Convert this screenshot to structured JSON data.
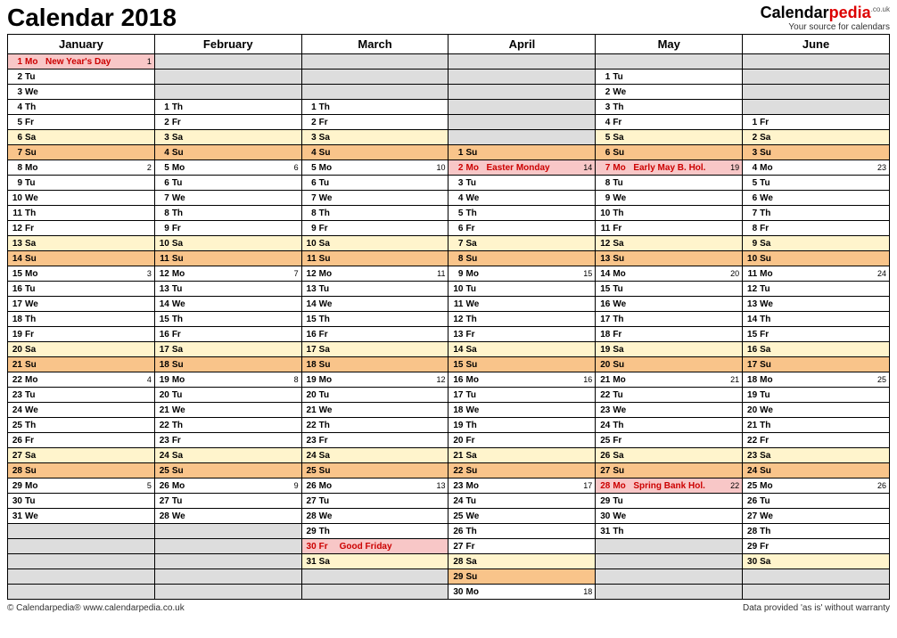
{
  "title": "Calendar 2018",
  "logo": {
    "part1": "Calendar",
    "part2": "pedia",
    "tld": ".co.uk",
    "tagline": "Your source for calendars"
  },
  "months": [
    "January",
    "February",
    "March",
    "April",
    "May",
    "June"
  ],
  "footer": {
    "left": "© Calendarpedia®   www.calendarpedia.co.uk",
    "right": "Data provided 'as is' without warranty"
  },
  "grid": [
    [
      {
        "d": 1,
        "w": "Mo",
        "ev": "New Year's Day",
        "wk": 1,
        "cls": "hol"
      },
      null,
      null,
      null,
      null,
      null
    ],
    [
      {
        "d": 2,
        "w": "Tu"
      },
      null,
      null,
      null,
      {
        "d": 1,
        "w": "Tu"
      },
      null
    ],
    [
      {
        "d": 3,
        "w": "We"
      },
      null,
      null,
      null,
      {
        "d": 2,
        "w": "We"
      },
      null
    ],
    [
      {
        "d": 4,
        "w": "Th"
      },
      {
        "d": 1,
        "w": "Th"
      },
      {
        "d": 1,
        "w": "Th"
      },
      null,
      {
        "d": 3,
        "w": "Th"
      },
      null
    ],
    [
      {
        "d": 5,
        "w": "Fr"
      },
      {
        "d": 2,
        "w": "Fr"
      },
      {
        "d": 2,
        "w": "Fr"
      },
      null,
      {
        "d": 4,
        "w": "Fr"
      },
      {
        "d": 1,
        "w": "Fr"
      }
    ],
    [
      {
        "d": 6,
        "w": "Sa",
        "cls": "sa"
      },
      {
        "d": 3,
        "w": "Sa",
        "cls": "sa"
      },
      {
        "d": 3,
        "w": "Sa",
        "cls": "sa"
      },
      null,
      {
        "d": 5,
        "w": "Sa",
        "cls": "sa"
      },
      {
        "d": 2,
        "w": "Sa",
        "cls": "sa"
      }
    ],
    [
      {
        "d": 7,
        "w": "Su",
        "cls": "su"
      },
      {
        "d": 4,
        "w": "Su",
        "cls": "su"
      },
      {
        "d": 4,
        "w": "Su",
        "cls": "su"
      },
      {
        "d": 1,
        "w": "Su",
        "cls": "su"
      },
      {
        "d": 6,
        "w": "Su",
        "cls": "su"
      },
      {
        "d": 3,
        "w": "Su",
        "cls": "su"
      }
    ],
    [
      {
        "d": 8,
        "w": "Mo",
        "wk": 2
      },
      {
        "d": 5,
        "w": "Mo",
        "wk": 6
      },
      {
        "d": 5,
        "w": "Mo",
        "wk": 10
      },
      {
        "d": 2,
        "w": "Mo",
        "ev": "Easter Monday",
        "wk": 14,
        "cls": "hol"
      },
      {
        "d": 7,
        "w": "Mo",
        "ev": "Early May B. Hol.",
        "wk": 19,
        "cls": "hol"
      },
      {
        "d": 4,
        "w": "Mo",
        "wk": 23
      }
    ],
    [
      {
        "d": 9,
        "w": "Tu"
      },
      {
        "d": 6,
        "w": "Tu"
      },
      {
        "d": 6,
        "w": "Tu"
      },
      {
        "d": 3,
        "w": "Tu"
      },
      {
        "d": 8,
        "w": "Tu"
      },
      {
        "d": 5,
        "w": "Tu"
      }
    ],
    [
      {
        "d": 10,
        "w": "We"
      },
      {
        "d": 7,
        "w": "We"
      },
      {
        "d": 7,
        "w": "We"
      },
      {
        "d": 4,
        "w": "We"
      },
      {
        "d": 9,
        "w": "We"
      },
      {
        "d": 6,
        "w": "We"
      }
    ],
    [
      {
        "d": 11,
        "w": "Th"
      },
      {
        "d": 8,
        "w": "Th"
      },
      {
        "d": 8,
        "w": "Th"
      },
      {
        "d": 5,
        "w": "Th"
      },
      {
        "d": 10,
        "w": "Th"
      },
      {
        "d": 7,
        "w": "Th"
      }
    ],
    [
      {
        "d": 12,
        "w": "Fr"
      },
      {
        "d": 9,
        "w": "Fr"
      },
      {
        "d": 9,
        "w": "Fr"
      },
      {
        "d": 6,
        "w": "Fr"
      },
      {
        "d": 11,
        "w": "Fr"
      },
      {
        "d": 8,
        "w": "Fr"
      }
    ],
    [
      {
        "d": 13,
        "w": "Sa",
        "cls": "sa"
      },
      {
        "d": 10,
        "w": "Sa",
        "cls": "sa"
      },
      {
        "d": 10,
        "w": "Sa",
        "cls": "sa"
      },
      {
        "d": 7,
        "w": "Sa",
        "cls": "sa"
      },
      {
        "d": 12,
        "w": "Sa",
        "cls": "sa"
      },
      {
        "d": 9,
        "w": "Sa",
        "cls": "sa"
      }
    ],
    [
      {
        "d": 14,
        "w": "Su",
        "cls": "su"
      },
      {
        "d": 11,
        "w": "Su",
        "cls": "su"
      },
      {
        "d": 11,
        "w": "Su",
        "cls": "su"
      },
      {
        "d": 8,
        "w": "Su",
        "cls": "su"
      },
      {
        "d": 13,
        "w": "Su",
        "cls": "su"
      },
      {
        "d": 10,
        "w": "Su",
        "cls": "su"
      }
    ],
    [
      {
        "d": 15,
        "w": "Mo",
        "wk": 3
      },
      {
        "d": 12,
        "w": "Mo",
        "wk": 7
      },
      {
        "d": 12,
        "w": "Mo",
        "wk": 11
      },
      {
        "d": 9,
        "w": "Mo",
        "wk": 15
      },
      {
        "d": 14,
        "w": "Mo",
        "wk": 20
      },
      {
        "d": 11,
        "w": "Mo",
        "wk": 24
      }
    ],
    [
      {
        "d": 16,
        "w": "Tu"
      },
      {
        "d": 13,
        "w": "Tu"
      },
      {
        "d": 13,
        "w": "Tu"
      },
      {
        "d": 10,
        "w": "Tu"
      },
      {
        "d": 15,
        "w": "Tu"
      },
      {
        "d": 12,
        "w": "Tu"
      }
    ],
    [
      {
        "d": 17,
        "w": "We"
      },
      {
        "d": 14,
        "w": "We"
      },
      {
        "d": 14,
        "w": "We"
      },
      {
        "d": 11,
        "w": "We"
      },
      {
        "d": 16,
        "w": "We"
      },
      {
        "d": 13,
        "w": "We"
      }
    ],
    [
      {
        "d": 18,
        "w": "Th"
      },
      {
        "d": 15,
        "w": "Th"
      },
      {
        "d": 15,
        "w": "Th"
      },
      {
        "d": 12,
        "w": "Th"
      },
      {
        "d": 17,
        "w": "Th"
      },
      {
        "d": 14,
        "w": "Th"
      }
    ],
    [
      {
        "d": 19,
        "w": "Fr"
      },
      {
        "d": 16,
        "w": "Fr"
      },
      {
        "d": 16,
        "w": "Fr"
      },
      {
        "d": 13,
        "w": "Fr"
      },
      {
        "d": 18,
        "w": "Fr"
      },
      {
        "d": 15,
        "w": "Fr"
      }
    ],
    [
      {
        "d": 20,
        "w": "Sa",
        "cls": "sa"
      },
      {
        "d": 17,
        "w": "Sa",
        "cls": "sa"
      },
      {
        "d": 17,
        "w": "Sa",
        "cls": "sa"
      },
      {
        "d": 14,
        "w": "Sa",
        "cls": "sa"
      },
      {
        "d": 19,
        "w": "Sa",
        "cls": "sa"
      },
      {
        "d": 16,
        "w": "Sa",
        "cls": "sa"
      }
    ],
    [
      {
        "d": 21,
        "w": "Su",
        "cls": "su"
      },
      {
        "d": 18,
        "w": "Su",
        "cls": "su"
      },
      {
        "d": 18,
        "w": "Su",
        "cls": "su"
      },
      {
        "d": 15,
        "w": "Su",
        "cls": "su"
      },
      {
        "d": 20,
        "w": "Su",
        "cls": "su"
      },
      {
        "d": 17,
        "w": "Su",
        "cls": "su"
      }
    ],
    [
      {
        "d": 22,
        "w": "Mo",
        "wk": 4
      },
      {
        "d": 19,
        "w": "Mo",
        "wk": 8
      },
      {
        "d": 19,
        "w": "Mo",
        "wk": 12
      },
      {
        "d": 16,
        "w": "Mo",
        "wk": 16
      },
      {
        "d": 21,
        "w": "Mo",
        "wk": 21
      },
      {
        "d": 18,
        "w": "Mo",
        "wk": 25
      }
    ],
    [
      {
        "d": 23,
        "w": "Tu"
      },
      {
        "d": 20,
        "w": "Tu"
      },
      {
        "d": 20,
        "w": "Tu"
      },
      {
        "d": 17,
        "w": "Tu"
      },
      {
        "d": 22,
        "w": "Tu"
      },
      {
        "d": 19,
        "w": "Tu"
      }
    ],
    [
      {
        "d": 24,
        "w": "We"
      },
      {
        "d": 21,
        "w": "We"
      },
      {
        "d": 21,
        "w": "We"
      },
      {
        "d": 18,
        "w": "We"
      },
      {
        "d": 23,
        "w": "We"
      },
      {
        "d": 20,
        "w": "We"
      }
    ],
    [
      {
        "d": 25,
        "w": "Th"
      },
      {
        "d": 22,
        "w": "Th"
      },
      {
        "d": 22,
        "w": "Th"
      },
      {
        "d": 19,
        "w": "Th"
      },
      {
        "d": 24,
        "w": "Th"
      },
      {
        "d": 21,
        "w": "Th"
      }
    ],
    [
      {
        "d": 26,
        "w": "Fr"
      },
      {
        "d": 23,
        "w": "Fr"
      },
      {
        "d": 23,
        "w": "Fr"
      },
      {
        "d": 20,
        "w": "Fr"
      },
      {
        "d": 25,
        "w": "Fr"
      },
      {
        "d": 22,
        "w": "Fr"
      }
    ],
    [
      {
        "d": 27,
        "w": "Sa",
        "cls": "sa"
      },
      {
        "d": 24,
        "w": "Sa",
        "cls": "sa"
      },
      {
        "d": 24,
        "w": "Sa",
        "cls": "sa"
      },
      {
        "d": 21,
        "w": "Sa",
        "cls": "sa"
      },
      {
        "d": 26,
        "w": "Sa",
        "cls": "sa"
      },
      {
        "d": 23,
        "w": "Sa",
        "cls": "sa"
      }
    ],
    [
      {
        "d": 28,
        "w": "Su",
        "cls": "su"
      },
      {
        "d": 25,
        "w": "Su",
        "cls": "su"
      },
      {
        "d": 25,
        "w": "Su",
        "cls": "su"
      },
      {
        "d": 22,
        "w": "Su",
        "cls": "su"
      },
      {
        "d": 27,
        "w": "Su",
        "cls": "su"
      },
      {
        "d": 24,
        "w": "Su",
        "cls": "su"
      }
    ],
    [
      {
        "d": 29,
        "w": "Mo",
        "wk": 5
      },
      {
        "d": 26,
        "w": "Mo",
        "wk": 9
      },
      {
        "d": 26,
        "w": "Mo",
        "wk": 13
      },
      {
        "d": 23,
        "w": "Mo",
        "wk": 17
      },
      {
        "d": 28,
        "w": "Mo",
        "ev": "Spring Bank Hol.",
        "wk": 22,
        "cls": "hol"
      },
      {
        "d": 25,
        "w": "Mo",
        "wk": 26
      }
    ],
    [
      {
        "d": 30,
        "w": "Tu"
      },
      {
        "d": 27,
        "w": "Tu"
      },
      {
        "d": 27,
        "w": "Tu"
      },
      {
        "d": 24,
        "w": "Tu"
      },
      {
        "d": 29,
        "w": "Tu"
      },
      {
        "d": 26,
        "w": "Tu"
      }
    ],
    [
      {
        "d": 31,
        "w": "We"
      },
      {
        "d": 28,
        "w": "We"
      },
      {
        "d": 28,
        "w": "We"
      },
      {
        "d": 25,
        "w": "We"
      },
      {
        "d": 30,
        "w": "We"
      },
      {
        "d": 27,
        "w": "We"
      }
    ],
    [
      null,
      null,
      {
        "d": 29,
        "w": "Th"
      },
      {
        "d": 26,
        "w": "Th"
      },
      {
        "d": 31,
        "w": "Th"
      },
      {
        "d": 28,
        "w": "Th"
      }
    ],
    [
      null,
      null,
      {
        "d": 30,
        "w": "Fr",
        "ev": "Good Friday",
        "cls": "hol"
      },
      {
        "d": 27,
        "w": "Fr"
      },
      null,
      {
        "d": 29,
        "w": "Fr"
      }
    ],
    [
      null,
      null,
      {
        "d": 31,
        "w": "Sa",
        "cls": "sa"
      },
      {
        "d": 28,
        "w": "Sa",
        "cls": "sa"
      },
      null,
      {
        "d": 30,
        "w": "Sa",
        "cls": "sa"
      }
    ],
    [
      null,
      null,
      null,
      {
        "d": 29,
        "w": "Su",
        "cls": "su"
      },
      null,
      null
    ],
    [
      null,
      null,
      null,
      {
        "d": 30,
        "w": "Mo",
        "wk": 18
      },
      null,
      null
    ]
  ]
}
